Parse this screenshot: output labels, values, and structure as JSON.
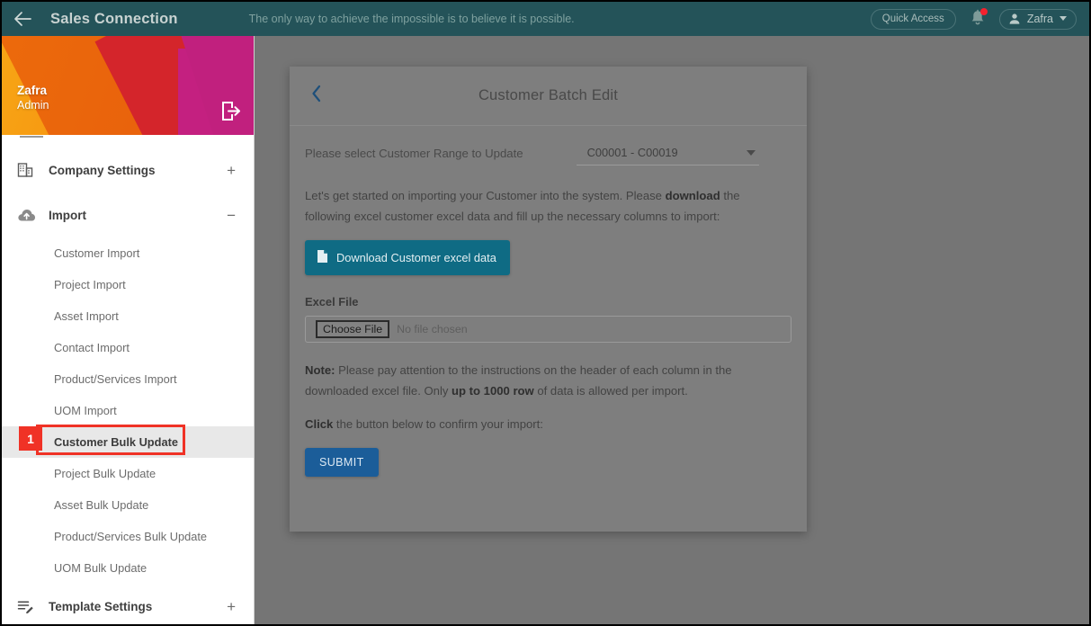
{
  "topbar": {
    "back_icon": "arrow-left-icon",
    "app_title": "Sales Connection",
    "tagline": "The only way to achieve the impossible is to believe it is possible.",
    "quick_access_label": "Quick Access",
    "bell_icon": "notification-bell-icon",
    "bell_has_badge": true,
    "user_icon": "person-icon",
    "user_name": "Zafra",
    "user_caret_icon": "chevron-down-icon",
    "bg_color": "#245359"
  },
  "sidebar": {
    "profile": {
      "name": "Zafra",
      "role": "Admin",
      "logout_icon": "logout-icon"
    },
    "groups": [
      {
        "label": "Company Settings",
        "icon": "building-icon",
        "toggle": "+",
        "expanded": false
      },
      {
        "label": "Import",
        "icon": "cloud-upload-icon",
        "toggle": "−",
        "expanded": true,
        "items": [
          {
            "label": "Customer Import",
            "active": false
          },
          {
            "label": "Project Import",
            "active": false
          },
          {
            "label": "Asset Import",
            "active": false
          },
          {
            "label": "Contact Import",
            "active": false
          },
          {
            "label": "Product/Services Import",
            "active": false
          },
          {
            "label": "UOM Import",
            "active": false
          },
          {
            "label": "Customer Bulk Update",
            "active": true
          },
          {
            "label": "Project Bulk Update",
            "active": false
          },
          {
            "label": "Asset Bulk Update",
            "active": false
          },
          {
            "label": "Product/Services Bulk Update",
            "active": false
          },
          {
            "label": "UOM Bulk Update",
            "active": false
          }
        ]
      },
      {
        "label": "Template Settings",
        "icon": "list-edit-icon",
        "toggle": "+",
        "expanded": false
      }
    ]
  },
  "annotation": {
    "step_number": "1",
    "color": "#f03226",
    "target": "Customer Bulk Update"
  },
  "modal": {
    "back_icon": "chevron-left-icon",
    "title": "Customer Batch Edit",
    "range_label": "Please select Customer Range to Update",
    "range_value": "C00001 - C00019",
    "range_caret_icon": "caret-down-icon",
    "intro_before": "Let's get started on importing your Customer into the system. Please ",
    "intro_bold": "download",
    "intro_after": " the following excel customer excel data and fill up the necessary columns to import:",
    "download_button": {
      "label": "Download Customer excel data",
      "icon": "file-document-icon",
      "color": "#0f6b84"
    },
    "excel_file_label": "Excel File",
    "file_input": {
      "button_label": "Choose File",
      "value": "",
      "placeholder": "No file chosen"
    },
    "note_bold": "Note:",
    "note_before": " Please pay attention to the instructions on the header of each column in the downloaded excel file. Only ",
    "note_bold2": "up to 1000 row",
    "note_after": " of data is allowed per import.",
    "click_bold": "Click",
    "click_after": " the button below to confirm your import:",
    "submit_button": {
      "label": "SUBMIT",
      "color": "#1b5d99"
    }
  }
}
